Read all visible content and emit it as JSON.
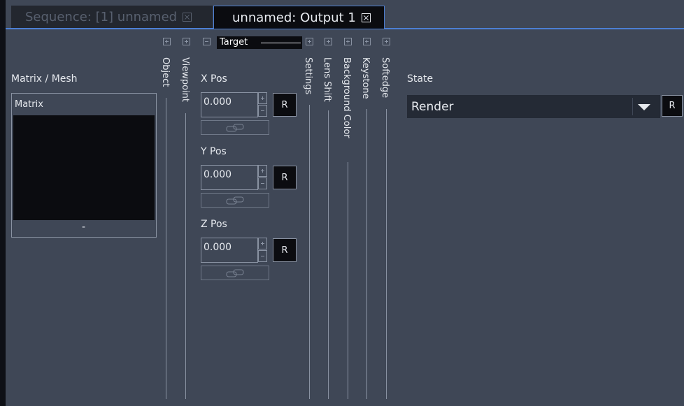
{
  "tabs": [
    {
      "label": "Sequence: [1] unnamed",
      "active": false
    },
    {
      "label": "unnamed: Output 1",
      "active": true
    }
  ],
  "matrix_panel": {
    "heading": "Matrix / Mesh",
    "title": "Matrix",
    "footer": "-"
  },
  "columns": {
    "object": "Object",
    "viewpoint": "Viewpoint",
    "target": "Target",
    "settings": "Settings",
    "lens_shift": "Lens Shift",
    "background_color": "Background Color",
    "keystone": "Keystone",
    "softedge": "Softedge"
  },
  "target": {
    "x_label": "X Pos",
    "x_value": "0.000",
    "y_label": "Y Pos",
    "y_value": "0.000",
    "z_label": "Z Pos",
    "z_value": "0.000",
    "reset_label": "R"
  },
  "state": {
    "label": "State",
    "value": "Render",
    "reset_label": "R"
  },
  "colors": {
    "background": "#3f4756",
    "dark": "#0b0c10",
    "accent": "#4c7fd4",
    "border": "#8a93a3"
  }
}
